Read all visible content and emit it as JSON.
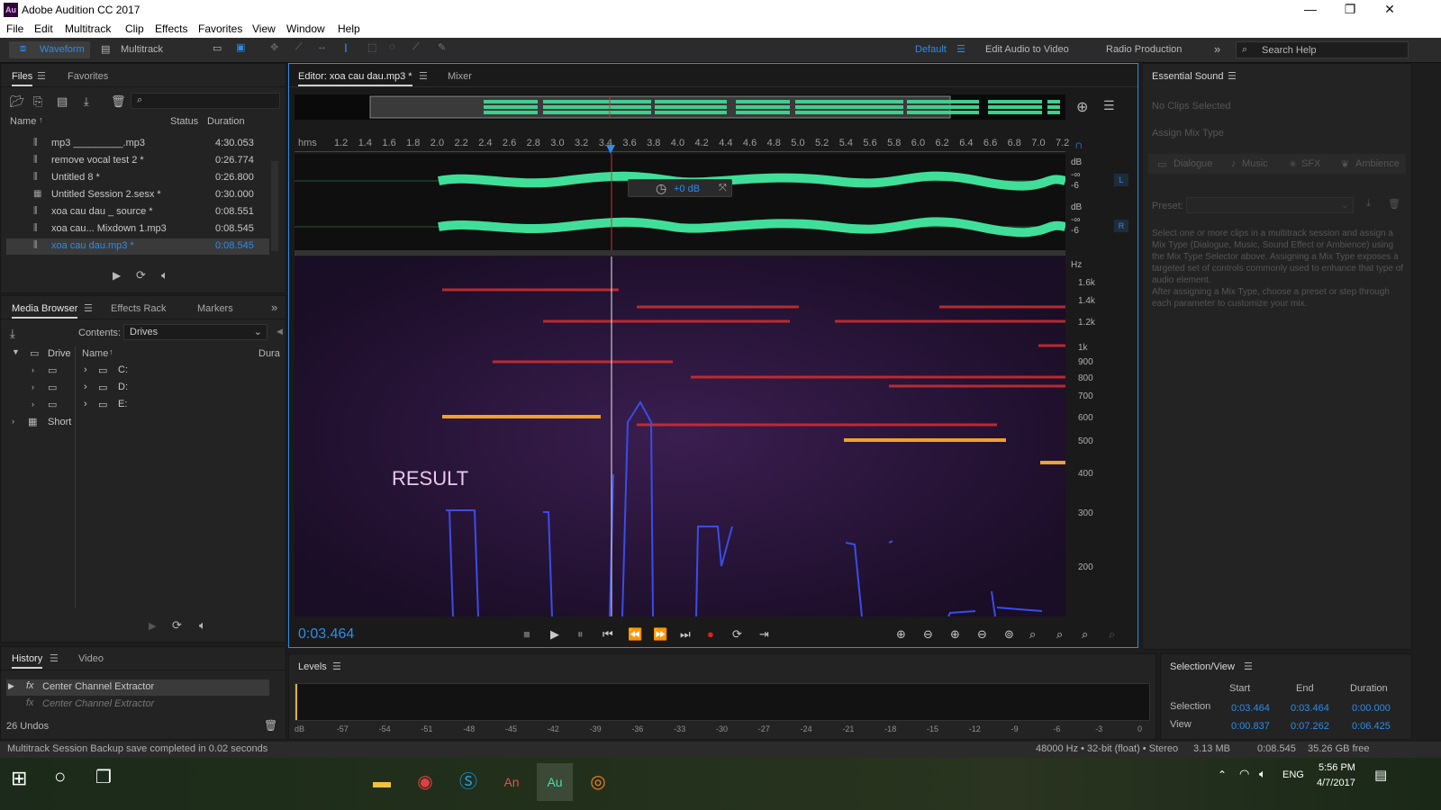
{
  "window": {
    "title": "Adobe Audition CC 2017",
    "app_icon": "Au",
    "controls": [
      "—",
      "❐",
      "✕"
    ]
  },
  "menu": [
    "File",
    "Edit",
    "Multitrack",
    "Clip",
    "Effects",
    "Favorites",
    "View",
    "Window",
    "Help"
  ],
  "toolbar": {
    "waveform": "Waveform",
    "multitrack": "Multitrack",
    "workspaces": [
      "Default",
      "Edit Audio to Video",
      "Radio Production"
    ],
    "search": "Search Help"
  },
  "files": {
    "tab1": "Files",
    "tab2": "Favorites",
    "col_name": "Name",
    "col_status": "Status",
    "col_duration": "Duration",
    "search_icon": "magnifier-icon",
    "items": [
      {
        "name": "mp3 _________.mp3",
        "duration": "4:30.053"
      },
      {
        "name": "remove vocal test 2 *",
        "duration": "0:26.774"
      },
      {
        "name": "Untitled 8 *",
        "duration": "0:26.800"
      },
      {
        "name": "Untitled Session 2.sesx *",
        "duration": "0:30.000"
      },
      {
        "name": "xoa cau dau _ source *",
        "duration": "0:08.551"
      },
      {
        "name": "xoa cau... Mixdown 1.mp3",
        "duration": "0:08.545"
      },
      {
        "name": "xoa cau dau.mp3 *",
        "duration": "0:08.545"
      }
    ]
  },
  "media": {
    "tab1": "Media Browser",
    "tab2": "Effects Rack",
    "tab3": "Markers",
    "contents_label": "Contents:",
    "contents_value": "Drives",
    "col_name": "Name",
    "col_dur": "Dura",
    "tree": [
      "Drive",
      "Short"
    ],
    "drives": [
      "C:",
      "D:",
      "E:"
    ]
  },
  "history": {
    "tab1": "History",
    "tab2": "Video",
    "items": [
      "Center Channel Extractor",
      "Center Channel Extractor"
    ],
    "undos": "26 Undos"
  },
  "editor": {
    "tab": "Editor: xoa cau dau.mp3 *",
    "mixer": "Mixer",
    "time": "0:03.464",
    "gain": "+0 dB",
    "overlay_text": "RESULT",
    "ruler_unit": "hms",
    "ruler": [
      "1.2",
      "1.4",
      "1.6",
      "1.8",
      "2.0",
      "2.2",
      "2.4",
      "2.6",
      "2.8",
      "3.0",
      "3.2",
      "3.4",
      "3.6",
      "3.8",
      "4.0",
      "4.2",
      "4.4",
      "4.6",
      "4.8",
      "5.0",
      "5.2",
      "5.4",
      "5.6",
      "5.8",
      "6.0",
      "6.2",
      "6.4",
      "6.6",
      "6.8",
      "7.0",
      "7.2"
    ],
    "db_labels": [
      "dB",
      "-∞",
      "-6",
      "dB",
      "-∞",
      "-6"
    ],
    "channels": [
      "L",
      "R"
    ],
    "hz_unit": "Hz",
    "hz": [
      "1.6k",
      "1.4k",
      "1.2k",
      "1k",
      "900",
      "800",
      "700",
      "600",
      "500",
      "400",
      "300",
      "200"
    ]
  },
  "levels": {
    "title": "Levels",
    "scale": [
      "dB",
      "-57",
      "-54",
      "-51",
      "-48",
      "-45",
      "-42",
      "-39",
      "-36",
      "-33",
      "-30",
      "-27",
      "-24",
      "-21",
      "-18",
      "-15",
      "-12",
      "-9",
      "-6",
      "-3",
      "0"
    ]
  },
  "essential": {
    "title": "Essential Sound",
    "no_clips": "No Clips Selected",
    "assign": "Assign Mix Type",
    "types": [
      "Dialogue",
      "Music",
      "SFX",
      "Ambience"
    ],
    "preset": "Preset:",
    "help": "Select one or more clips in a multitrack session and assign a Mix Type (Dialogue, Music, Sound Effect or Ambience) using the Mix Type Selector above. Assigning a Mix Type exposes a targeted set of controls commonly used to enhance that type of audio element.\nAfter assigning a Mix Type, choose a preset or step through each parameter to customize your mix."
  },
  "selview": {
    "title": "Selection/View",
    "start": "Start",
    "end": "End",
    "duration": "Duration",
    "selection": {
      "label": "Selection",
      "start": "0:03.464",
      "end": "0:03.464",
      "duration": "0:00.000"
    },
    "view": {
      "label": "View",
      "start": "0:00.837",
      "end": "0:07.262",
      "duration": "0:06.425"
    }
  },
  "status": {
    "left": "Multitrack Session Backup save completed in 0.02 seconds",
    "format": "48000 Hz • 32-bit (float) • Stereo",
    "size": "3.13 MB",
    "dur": "0:08.545",
    "free": "35.26 GB free"
  },
  "taskbar": {
    "time": "5:56 PM",
    "date": "4/7/2017",
    "lang": "ENG",
    "apps": [
      "file-explorer-icon",
      "chrome-icon",
      "skype-icon",
      "animate-icon",
      "audition-icon",
      "firefox-icon"
    ]
  }
}
